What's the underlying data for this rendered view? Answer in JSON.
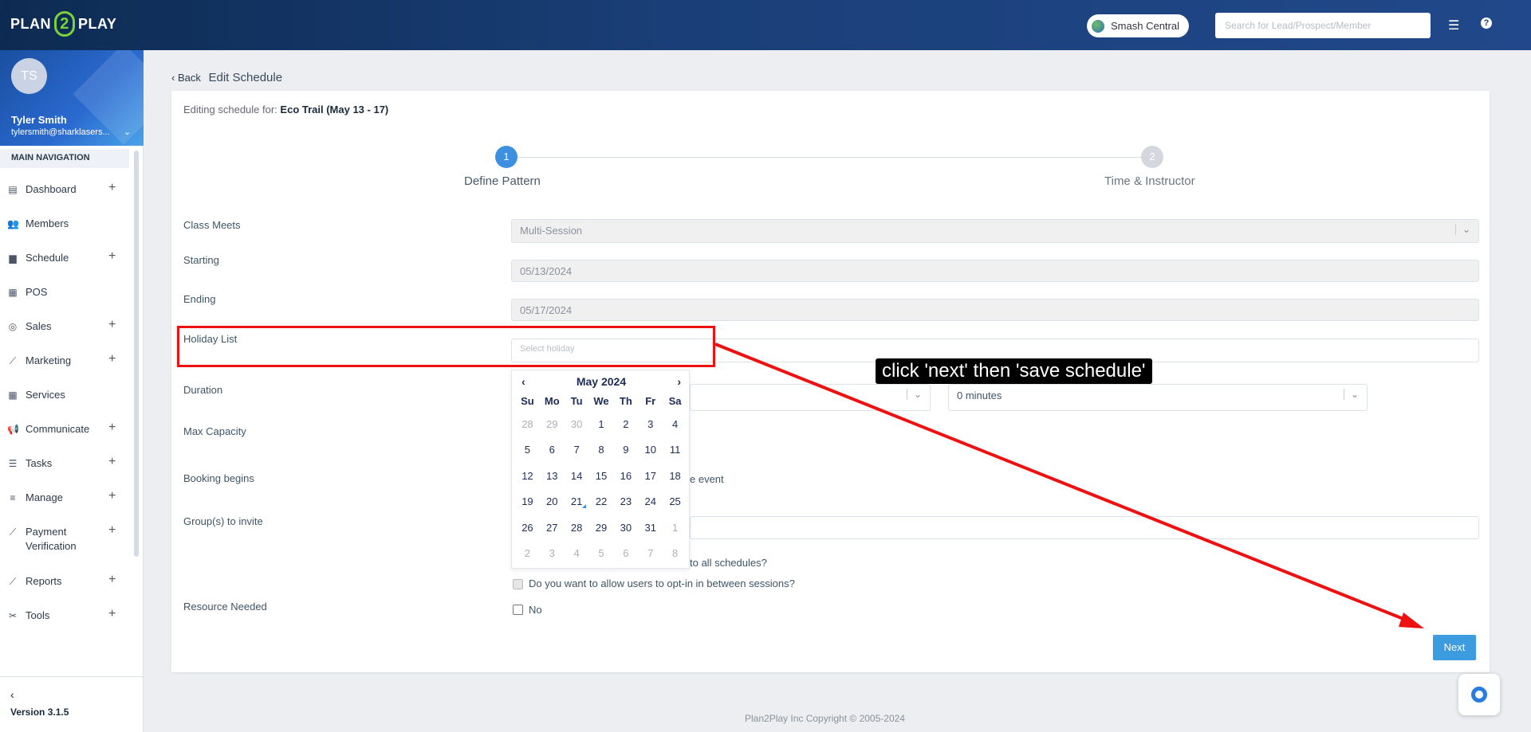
{
  "header": {
    "logo_left": "PLAN",
    "logo_mid": "2",
    "logo_right": "PLAY",
    "location": "Smash Central",
    "search_placeholder": "Search for Lead/Prospect/Member"
  },
  "user": {
    "initials": "TS",
    "name": "Tyler Smith",
    "email": "tylersmith@sharklasers..."
  },
  "sidebar": {
    "heading": "MAIN NAVIGATION",
    "items": [
      {
        "label": "Dashboard",
        "icon": "chart-icon",
        "glyph": "▤",
        "expand": "+"
      },
      {
        "label": "Members",
        "icon": "members-icon",
        "glyph": "👥",
        "expand": ""
      },
      {
        "label": "Schedule",
        "icon": "calendar-icon",
        "glyph": "▆",
        "expand": "+"
      },
      {
        "label": "POS",
        "icon": "grid-icon",
        "glyph": "▦",
        "expand": ""
      },
      {
        "label": "Sales",
        "icon": "target-icon",
        "glyph": "◎",
        "expand": "+"
      },
      {
        "label": "Marketing",
        "icon": "line-chart-icon",
        "glyph": "⟋",
        "expand": "+"
      },
      {
        "label": "Services",
        "icon": "grid-icon",
        "glyph": "▦",
        "expand": ""
      },
      {
        "label": "Communicate",
        "icon": "megaphone-icon",
        "glyph": "📢",
        "expand": "+"
      },
      {
        "label": "Tasks",
        "icon": "list-icon",
        "glyph": "☰",
        "expand": "+"
      },
      {
        "label": "Manage",
        "icon": "bars-icon",
        "glyph": "≡",
        "expand": "+"
      },
      {
        "label": "Payment\nVerification",
        "icon": "line-chart-icon",
        "glyph": "⟋",
        "expand": "+"
      },
      {
        "label": "Reports",
        "icon": "line-chart-icon",
        "glyph": "⟋",
        "expand": "+"
      },
      {
        "label": "Tools",
        "icon": "tools-icon",
        "glyph": "✂",
        "expand": "+"
      }
    ],
    "back_glyph": "‹",
    "version": "Version 3.1.5"
  },
  "page": {
    "back": "Back",
    "title": "Edit Schedule",
    "editing_prefix": "Editing schedule for:",
    "editing_name": "Eco Trail (May 13 - 17)"
  },
  "steps": [
    {
      "num": "1",
      "label": "Define Pattern"
    },
    {
      "num": "2",
      "label": "Time & Instructor"
    }
  ],
  "form": {
    "class_meets_label": "Class Meets",
    "class_meets_value": "Multi-Session",
    "starting_label": "Starting",
    "starting_value": "05/13/2024",
    "ending_label": "Ending",
    "ending_value": "05/17/2024",
    "holiday_label": "Holiday List",
    "holiday_placeholder": "Select holiday",
    "duration_label": "Duration",
    "duration_minutes": "0 minutes",
    "max_capacity_label": "Max Capacity",
    "booking_label": "Booking begins",
    "booking_suffix": "e event",
    "groups_label": "Group(s) to invite",
    "apply_all_suffix": "to all schedules?",
    "optin_label": "Do you want to allow users to opt-in in between sessions?",
    "resource_label": "Resource Needed",
    "resource_value": "No",
    "next_button": "Next"
  },
  "calendar": {
    "prev": "‹",
    "next": "›",
    "month": "May 2024",
    "weekdays": [
      "Su",
      "Mo",
      "Tu",
      "We",
      "Th",
      "Fr",
      "Sa"
    ],
    "days": [
      [
        "28",
        true
      ],
      [
        "29",
        true
      ],
      [
        "30",
        true
      ],
      [
        "1",
        false
      ],
      [
        "2",
        false
      ],
      [
        "3",
        false
      ],
      [
        "4",
        false
      ],
      [
        "5",
        false
      ],
      [
        "6",
        false
      ],
      [
        "7",
        false
      ],
      [
        "8",
        false
      ],
      [
        "9",
        false
      ],
      [
        "10",
        false
      ],
      [
        "11",
        false
      ],
      [
        "12",
        false
      ],
      [
        "13",
        false
      ],
      [
        "14",
        false
      ],
      [
        "15",
        false
      ],
      [
        "16",
        false
      ],
      [
        "17",
        false
      ],
      [
        "18",
        false
      ],
      [
        "19",
        false
      ],
      [
        "20",
        false
      ],
      [
        "21",
        false
      ],
      [
        "22",
        false
      ],
      [
        "23",
        false
      ],
      [
        "24",
        false
      ],
      [
        "25",
        false
      ],
      [
        "26",
        false
      ],
      [
        "27",
        false
      ],
      [
        "28",
        false
      ],
      [
        "29",
        false
      ],
      [
        "30",
        false
      ],
      [
        "31",
        false
      ],
      [
        "1",
        true
      ],
      [
        "2",
        true
      ],
      [
        "3",
        true
      ],
      [
        "4",
        true
      ],
      [
        "5",
        true
      ],
      [
        "6",
        true
      ],
      [
        "7",
        true
      ],
      [
        "8",
        true
      ]
    ],
    "today": "21"
  },
  "annotation": {
    "text": "click 'next' then 'save schedule'",
    "color": "#ee1111"
  },
  "footer": "Plan2Play Inc Copyright © 2005-2024"
}
